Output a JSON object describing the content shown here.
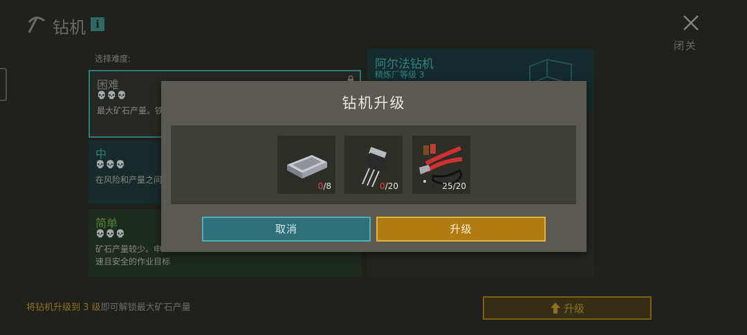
{
  "header": {
    "title": "钻机",
    "info_badge": "i",
    "close_label": "关闭"
  },
  "difficulty": {
    "label": "选择难度:",
    "options": [
      {
        "title": "困难",
        "skulls": "💀💀💀",
        "desc": "最大矿石产量。铁"
      },
      {
        "title": "中",
        "skulls": "💀💀💀",
        "desc": "在风险和产量之间"
      },
      {
        "title": "简单",
        "skulls": "💀💀💀",
        "desc_line1": "矿石产量较少。申",
        "desc_line2": "速且安全的作业目标"
      }
    ]
  },
  "drill": {
    "name": "阿尔法钻机",
    "level": "精炼厂等级 3"
  },
  "footer": {
    "hint_prefix": "将钻机升级到",
    "hint_level": "3 级",
    "hint_suffix": "即可解锁最大矿石产量",
    "upgrade_button": "升级"
  },
  "modal": {
    "title": "钻机升级",
    "items": [
      {
        "icon": "metal-ingot-icon",
        "have": "0",
        "need": "/8"
      },
      {
        "icon": "transistor-icon",
        "have": "0",
        "need": "/20"
      },
      {
        "icon": "tools-pliers-icon",
        "have": "25",
        "need": "/20"
      }
    ],
    "cancel_label": "取消",
    "upgrade_label": "升级"
  },
  "colors": {
    "accent_teal": "#3aa8a0",
    "accent_gold": "#b07b12",
    "missing_red": "#e04a3a"
  }
}
